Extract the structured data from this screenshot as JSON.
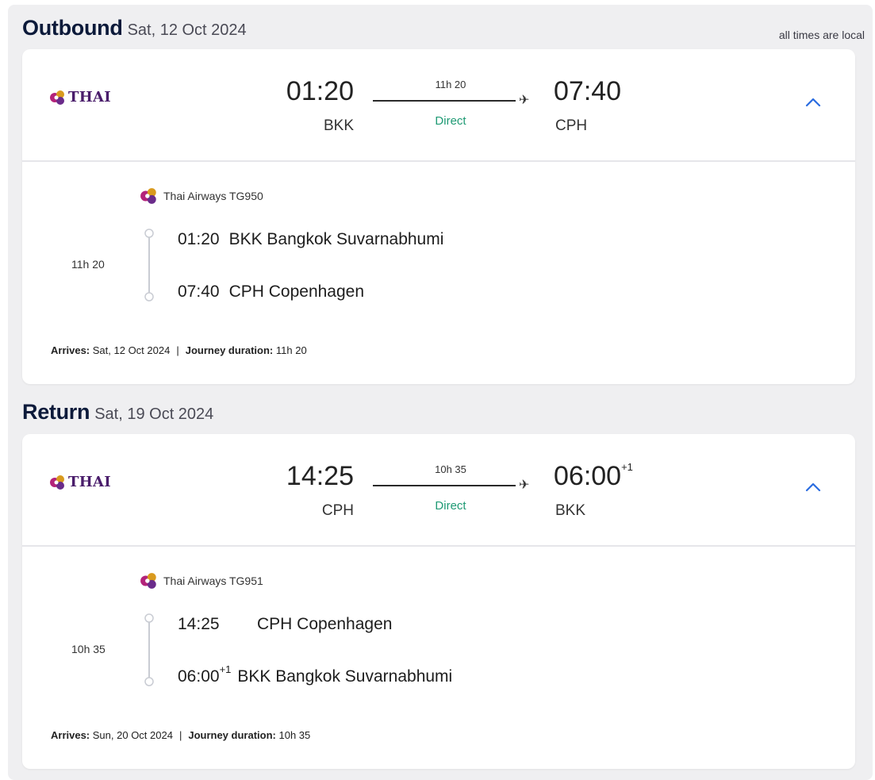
{
  "outbound": {
    "title": "Outbound",
    "date": "Sat, 12 Oct 2024",
    "note": "all times are local",
    "airline_logo_text": "THAI",
    "dep_time": "01:20",
    "dep_code": "BKK",
    "duration": "11h 20",
    "stops": "Direct",
    "arr_time": "07:40",
    "arr_suffix": "",
    "arr_code": "CPH",
    "carrier": "Thai Airways TG950",
    "leg_duration": "11h 20",
    "stop1_time": "01:20",
    "stop1_suffix": "",
    "stop1_place": "BKK Bangkok Suvarnabhumi",
    "stop2_time": "07:40",
    "stop2_suffix": "",
    "stop2_place": "CPH Copenhagen",
    "arrives_label": "Arrives:",
    "arrives_value": "Sat, 12 Oct 2024",
    "separator": "|",
    "journey_label": "Journey duration:",
    "journey_value": "11h 20"
  },
  "return": {
    "title": "Return",
    "date": "Sat, 19 Oct 2024",
    "airline_logo_text": "THAI",
    "dep_time": "14:25",
    "dep_code": "CPH",
    "duration": "10h 35",
    "stops": "Direct",
    "arr_time": "06:00",
    "arr_suffix": "+1",
    "arr_code": "BKK",
    "carrier": "Thai Airways TG951",
    "leg_duration": "10h 35",
    "stop1_time": "14:25",
    "stop1_suffix": "",
    "stop1_place": "CPH Copenhagen",
    "stop2_time": "06:00",
    "stop2_suffix": "+1",
    "stop2_place": "BKK Bangkok Suvarnabhumi",
    "arrives_label": "Arrives:",
    "arrives_value": "Sun, 20 Oct 2024",
    "separator": "|",
    "journey_label": "Journey duration:",
    "journey_value": "10h 35"
  },
  "colors": {
    "panel_bg": "#efeff1",
    "accent_chevron": "#2b6de0",
    "direct_green": "#1f9a74",
    "thai_purple": "#4a1d6b",
    "thai_gold": "#d99a1e",
    "thai_pink": "#b3237a"
  },
  "icons": {
    "logo": "thai-orchid-logo-icon",
    "plane": "airplane-icon",
    "expand": "chevron-up-icon"
  }
}
